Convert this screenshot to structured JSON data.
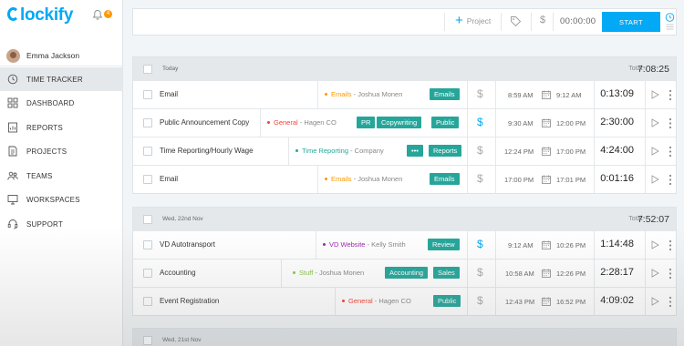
{
  "app": {
    "logo_text": "lockify",
    "notification_count": "4",
    "brand_color": "#03a9f4"
  },
  "user": {
    "name": "Emma Jackson"
  },
  "sidebar": {
    "items": [
      {
        "label": "TIME TRACKER",
        "icon": "clock-icon",
        "active": true
      },
      {
        "label": "DASHBOARD",
        "icon": "dashboard-icon"
      },
      {
        "label": "REPORTS",
        "icon": "reports-icon"
      },
      {
        "label": "PROJECTS",
        "icon": "projects-icon"
      },
      {
        "label": "TEAMS",
        "icon": "teams-icon"
      },
      {
        "label": "WORKSPACES",
        "icon": "workspaces-icon"
      },
      {
        "label": "SUPPORT",
        "icon": "support-icon"
      }
    ]
  },
  "topbar": {
    "description_value": "",
    "project_label": "Project",
    "timer": "00:00:00",
    "start_label": "START"
  },
  "groups": [
    {
      "date": "Today",
      "total_label": "Total:",
      "total": "7:08:25",
      "entries": [
        {
          "description": "Email",
          "project": "Emails",
          "client": "Joshua Monen",
          "project_color": "#ff9800",
          "tags": [
            "Emails"
          ],
          "billable": false,
          "start": "8:59 AM",
          "end": "9:12 AM",
          "duration": "0:13:09"
        },
        {
          "description": "Public Announcement Copy",
          "project": "General",
          "client": "Hagen CO",
          "project_color": "#f44336",
          "tags": [
            "PR",
            "Copywriting",
            "Public"
          ],
          "billable": true,
          "start": "9:30 AM",
          "end": "12:00 PM",
          "duration": "2:30:00"
        },
        {
          "description": "Time Reporting/Hourly Wage",
          "project": "Time Reporting",
          "client": "Company",
          "project_color": "#26a69a",
          "tags": [
            "•••",
            "Reports"
          ],
          "billable": false,
          "start": "12:24 PM",
          "end": "17:00 PM",
          "duration": "4:24:00"
        },
        {
          "description": "Email",
          "project": "Emails",
          "client": "Joshua Monen",
          "project_color": "#ff9800",
          "tags": [
            "Emails"
          ],
          "billable": false,
          "start": "17:00 PM",
          "end": "17:01 PM",
          "duration": "0:01:16"
        }
      ]
    },
    {
      "date": "Wed, 22nd Nov",
      "total_label": "Total:",
      "total": "7:52:07",
      "entries": [
        {
          "description": "VD Autotransport",
          "project": "VD Website",
          "client": "Kelly Smith",
          "project_color": "#9c27b0",
          "tags": [
            "Review"
          ],
          "billable": true,
          "start": "9:12 AM",
          "end": "10:26 PM",
          "duration": "1:14:48"
        },
        {
          "description": "Accounting",
          "project": "Stuff",
          "client": "Joshua Monen",
          "project_color": "#8bc34a",
          "tags": [
            "Accounting",
            "Sales"
          ],
          "billable": false,
          "start": "10:58 AM",
          "end": "12:26 PM",
          "duration": "2:28:17"
        },
        {
          "description": "Event Registration",
          "project": "General",
          "client": "Hagen CO",
          "project_color": "#f44336",
          "tags": [
            "Public"
          ],
          "billable": false,
          "start": "12:43 PM",
          "end": "16:52 PM",
          "duration": "4:09:02"
        }
      ]
    },
    {
      "date": "Wed, 21st Nov"
    }
  ]
}
